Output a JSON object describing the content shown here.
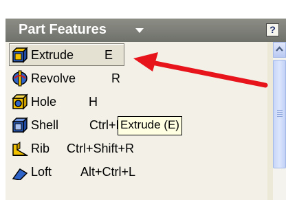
{
  "panel": {
    "title": "Part Features",
    "help_label": "?"
  },
  "items": [
    {
      "label": "Extrude",
      "key": "E",
      "icon": "extrude-icon",
      "selected": true
    },
    {
      "label": "Revolve",
      "key": "R",
      "icon": "revolve-icon"
    },
    {
      "label": "Hole",
      "key": "H",
      "icon": "hole-icon"
    },
    {
      "label": "Shell",
      "key": "Ctrl+L",
      "icon": "shell-icon"
    },
    {
      "label": "Rib",
      "key": "Ctrl+Shift+R",
      "icon": "rib-icon"
    },
    {
      "label": "Loft",
      "key": "Alt+Ctrl+L",
      "icon": "loft-icon"
    }
  ],
  "tooltip": {
    "text": "Extrude (E)"
  },
  "annotation": {
    "arrow_color": "#e8141c"
  },
  "colors": {
    "header": "#7c7e78",
    "panel_bg": "#ece9d8",
    "tooltip_bg": "#ffffe1",
    "scrollbar": "#c8d6f8"
  }
}
